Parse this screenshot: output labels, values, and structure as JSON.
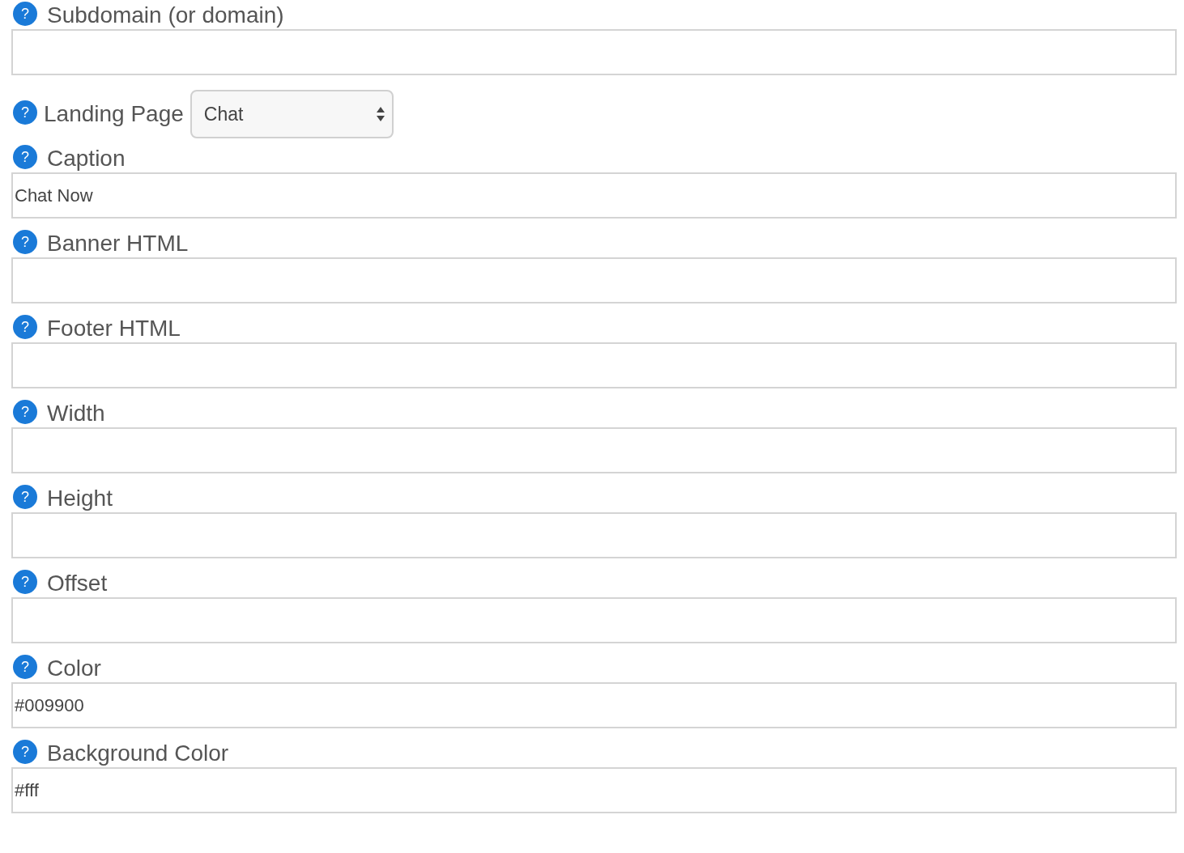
{
  "fields": [
    {
      "kind": "text",
      "help": "?",
      "label": "Subdomain (or domain)"
    },
    {
      "kind": "select",
      "help": "?",
      "label": "Landing Page",
      "value": "Chat"
    },
    {
      "kind": "text",
      "help": "?",
      "label": "Caption",
      "value": "Chat Now"
    },
    {
      "kind": "text",
      "help": "?",
      "label": "Banner HTML"
    },
    {
      "kind": "text",
      "help": "?",
      "label": "Footer HTML"
    },
    {
      "kind": "text",
      "help": "?",
      "label": "Width"
    },
    {
      "kind": "text",
      "help": "?",
      "label": "Height"
    },
    {
      "kind": "text",
      "help": "?",
      "label": "Offset"
    },
    {
      "kind": "text",
      "help": "?",
      "label": "Color",
      "value": "#009900"
    },
    {
      "kind": "text",
      "help": "?",
      "label": "Background Color",
      "value": "#fff"
    }
  ]
}
